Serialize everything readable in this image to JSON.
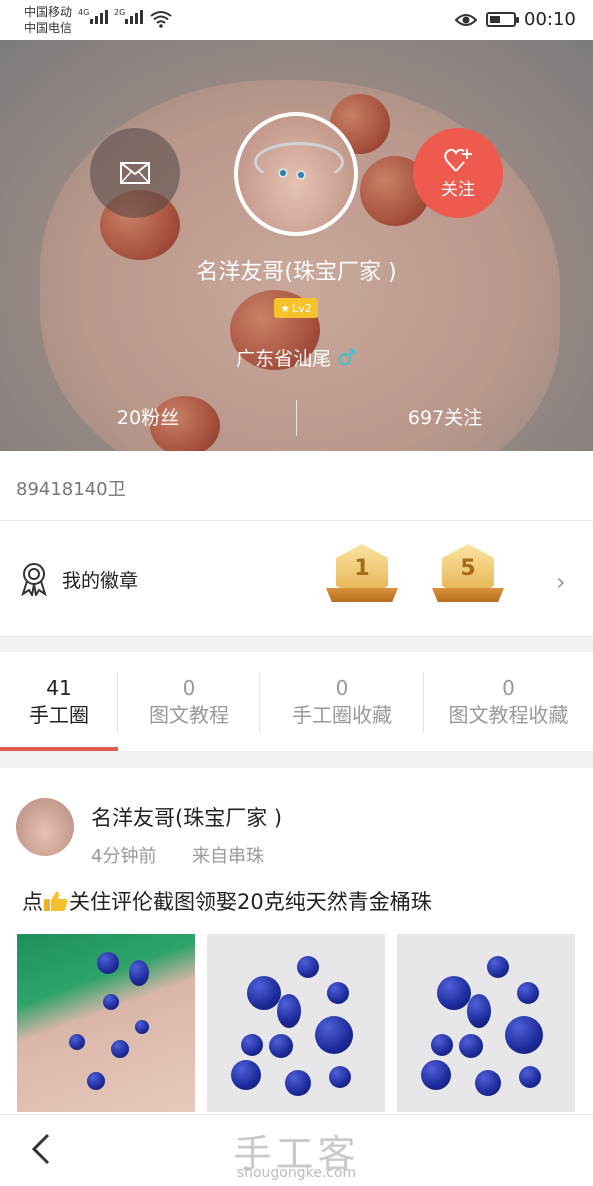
{
  "status_bar": {
    "carrier1": "中国移动",
    "carrier2": "中国电信",
    "net1": "4G",
    "net2": "2G",
    "time": "00:10"
  },
  "profile": {
    "name": "名洋友哥(珠宝厂家 )",
    "level": "Lv2",
    "location": "广东省汕尾",
    "gender_symbol": "♂",
    "follow_label": "关注",
    "fans": "20粉丝",
    "following": "697关注"
  },
  "user_id": "89418140卫",
  "badges": {
    "label": "我的徽章",
    "items": [
      "1",
      "5"
    ]
  },
  "tabs": [
    {
      "count": "41",
      "label": "手工圈"
    },
    {
      "count": "0",
      "label": "图文教程"
    },
    {
      "count": "0",
      "label": "手工圈收藏"
    },
    {
      "count": "0",
      "label": "图文教程收藏"
    }
  ],
  "post": {
    "author": "名洋友哥(珠宝厂家 )",
    "time": "4分钟前",
    "source": "来自串珠",
    "text_before": "点",
    "text_after": "关住评伦截图领娶20克纯天然青金桶珠"
  },
  "watermark": {
    "cn": "手工客",
    "en": "shougongke.com"
  },
  "colors": {
    "accent": "#ef5a4f",
    "level_badge": "#f6c12b",
    "male": "#3cc6d0"
  }
}
